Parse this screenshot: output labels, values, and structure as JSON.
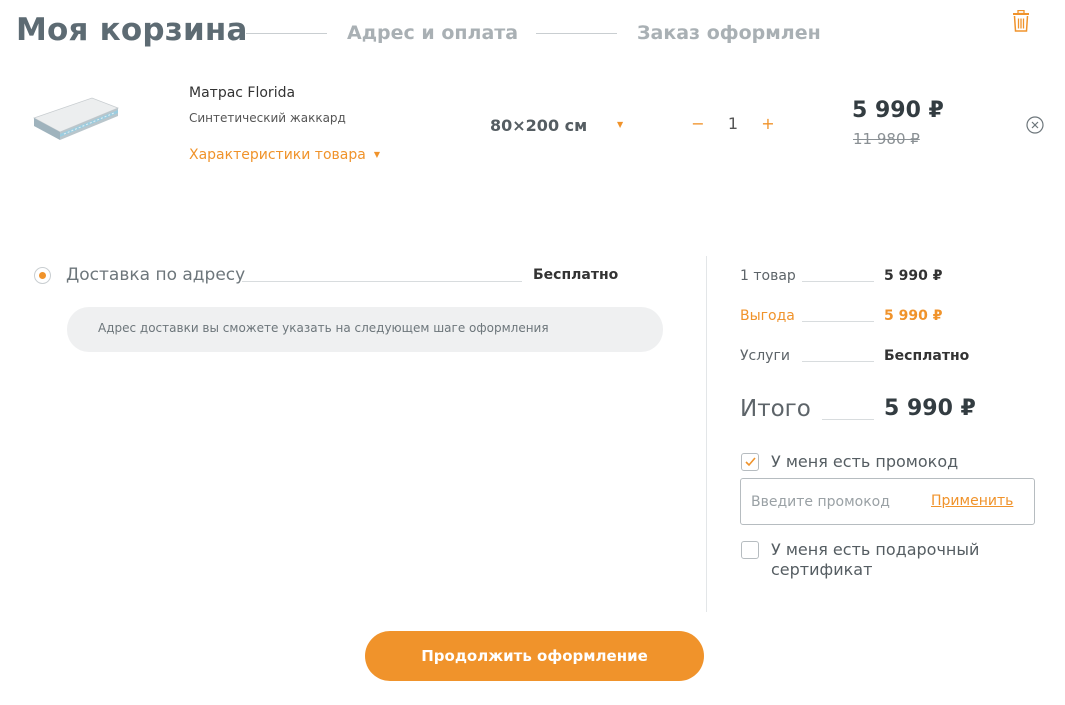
{
  "header": {
    "step_active": "Моя корзина",
    "step_2": "Адрес и оплата",
    "step_3": "Заказ оформлен",
    "trash_icon": "trash-icon"
  },
  "product": {
    "name": "Матрас Florida",
    "material": "Синтетический жаккард",
    "characteristics_link": "Характеристики товара",
    "size": "80×200 см",
    "quantity": "1",
    "minus": "−",
    "plus": "+",
    "price": "5 990 ₽",
    "old_price": "11 980 ₽",
    "image_icon": "mattress-image"
  },
  "delivery": {
    "option_label": "Доставка по адресу",
    "option_price": "Бесплатно",
    "note": "Адрес доставки вы сможете указать на следующем шаге оформления"
  },
  "summary": {
    "items_label": "1 товар",
    "items_value": "5 990 ₽",
    "savings_label": "Выгода",
    "savings_value": "5 990 ₽",
    "services_label": "Услуги",
    "services_value": "Бесплатно",
    "total_label": "Итого",
    "total_value": "5 990 ₽"
  },
  "promo": {
    "checkbox_label": "У меня есть промокод",
    "checked": true,
    "input_placeholder": "Введите промокод",
    "apply_label": "Применить"
  },
  "gift": {
    "checkbox_label_line1": "У меня есть подарочный",
    "checkbox_label_line2": "сертификат",
    "checked": false
  },
  "actions": {
    "continue_label": "Продолжить оформление"
  },
  "colors": {
    "accent": "#f0932b",
    "text_dark": "#333c41",
    "text_muted": "#a9b0b4"
  }
}
